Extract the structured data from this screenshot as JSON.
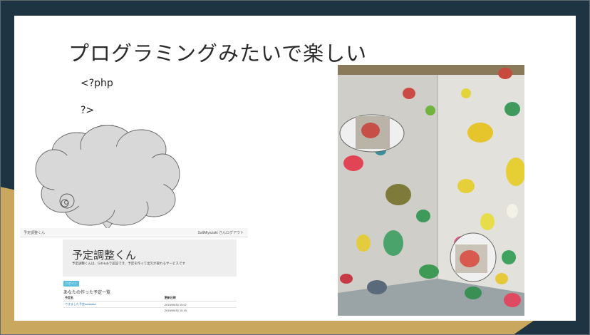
{
  "slide": {
    "title": "プログラミングみたいで楽しい",
    "code_open": "<?php",
    "code_close": "?>"
  },
  "app_screenshot": {
    "nav_brand": "予定調整くん",
    "nav_user": "SaltMiyazaki さんログアウト",
    "heading": "予定調整くん",
    "description": "予定調整くんは、GitHubで認証でき、予定を作って出欠が取れるサービスです",
    "login_button": "ログイン",
    "list_title": "あなたの作った予定一覧",
    "columns": [
      "予定名",
      "更新日時"
    ],
    "rows": [
      [
        "できました予定aaaaaaa",
        "2019/09/30 19:07"
      ],
      [
        "",
        "2019/09/30 15:19"
      ]
    ]
  },
  "colors": {
    "background_dark": "#1f3442",
    "background_gold": "#c9a75f",
    "slide": "#ffffff",
    "cloud_fill": "#d8d8d8",
    "button_accent": "#5bc0de"
  },
  "icons": [
    "thought-cloud-icon",
    "magnifier-icon"
  ]
}
